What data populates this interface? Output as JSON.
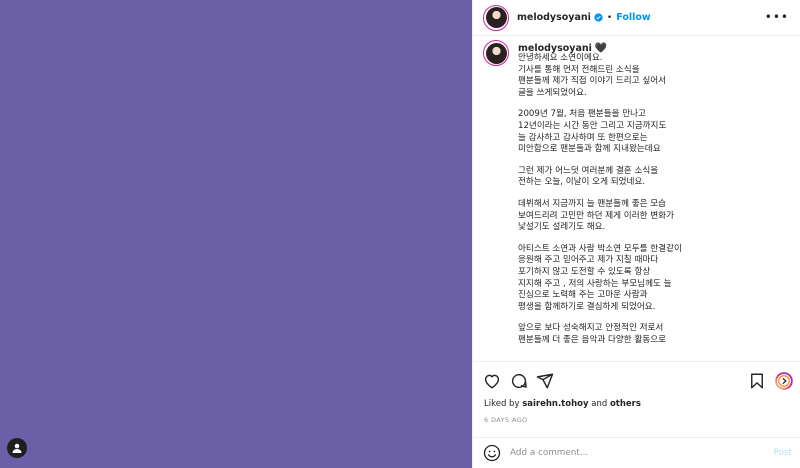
{
  "post": {
    "username": "melodysoyani",
    "follow_label": "Follow",
    "separator": "•"
  },
  "caption": {
    "username": "melodysoyani",
    "heart": "🖤",
    "paragraphs": [
      [
        "안녕하세요 소연이에요.",
        "기사를 통해 먼저 전해드린 소식을",
        "팬분들께 제가 직접 이야기 드리고 싶어서",
        "글을 쓰게되었어요."
      ],
      [
        "2009년 7월, 처음 팬분들을 만나고",
        "12년이라는 시간 동안 그리고 지금까지도",
        "늘 감사하고 감사하며 또 한편으로는",
        "미안함으로 팬분들과 함께 지내왔는데요"
      ],
      [
        "그런 제가 어느덧 여러분께 결혼 소식을",
        "전하는 오늘, 이날이 오게 되었네요."
      ],
      [
        "데뷔해서 지금까지 늘 팬분들께 좋은 모습",
        "보여드리려 고민만 하던 제게 이러한 변화가",
        "낯설기도 설레기도 해요."
      ],
      [
        "아티스트 소연과 사람 박소연 모두를 한결같이",
        "응원해 주고 믿어주고 제가 지칠 때마다",
        "포기하지 않고 도전할 수 있도록 항상",
        "지지해 주고 , 저의 사랑하는 부모님께도 늘",
        "진심으로 노력해 주는 고마운 사람과",
        "평생을 함께하기로 결심하게 되었어요."
      ],
      [
        "앞으로 보다 성숙해지고 안정적인 저로서",
        "팬분들께 더 좋은 음악과 다양한 활동으로"
      ]
    ]
  },
  "likes": {
    "prefix": "Liked by",
    "user": "sairehn.tohoy",
    "conjunction": "and",
    "others": "others"
  },
  "timestamp": "6 DAYS AGO",
  "comment": {
    "placeholder": "Add a comment...",
    "post_label": "Post"
  },
  "icons": {
    "verified": "verified-badge-icon",
    "more": "more-options-icon",
    "like": "heart-icon",
    "comment": "comment-icon",
    "share": "share-icon",
    "save": "bookmark-icon",
    "emoji": "emoji-icon",
    "story": "story-ring-icon",
    "user": "user-icon"
  },
  "colors": {
    "media_bg": "#6b60a8",
    "accent": "#0095f6",
    "verified": "#0095f6"
  }
}
